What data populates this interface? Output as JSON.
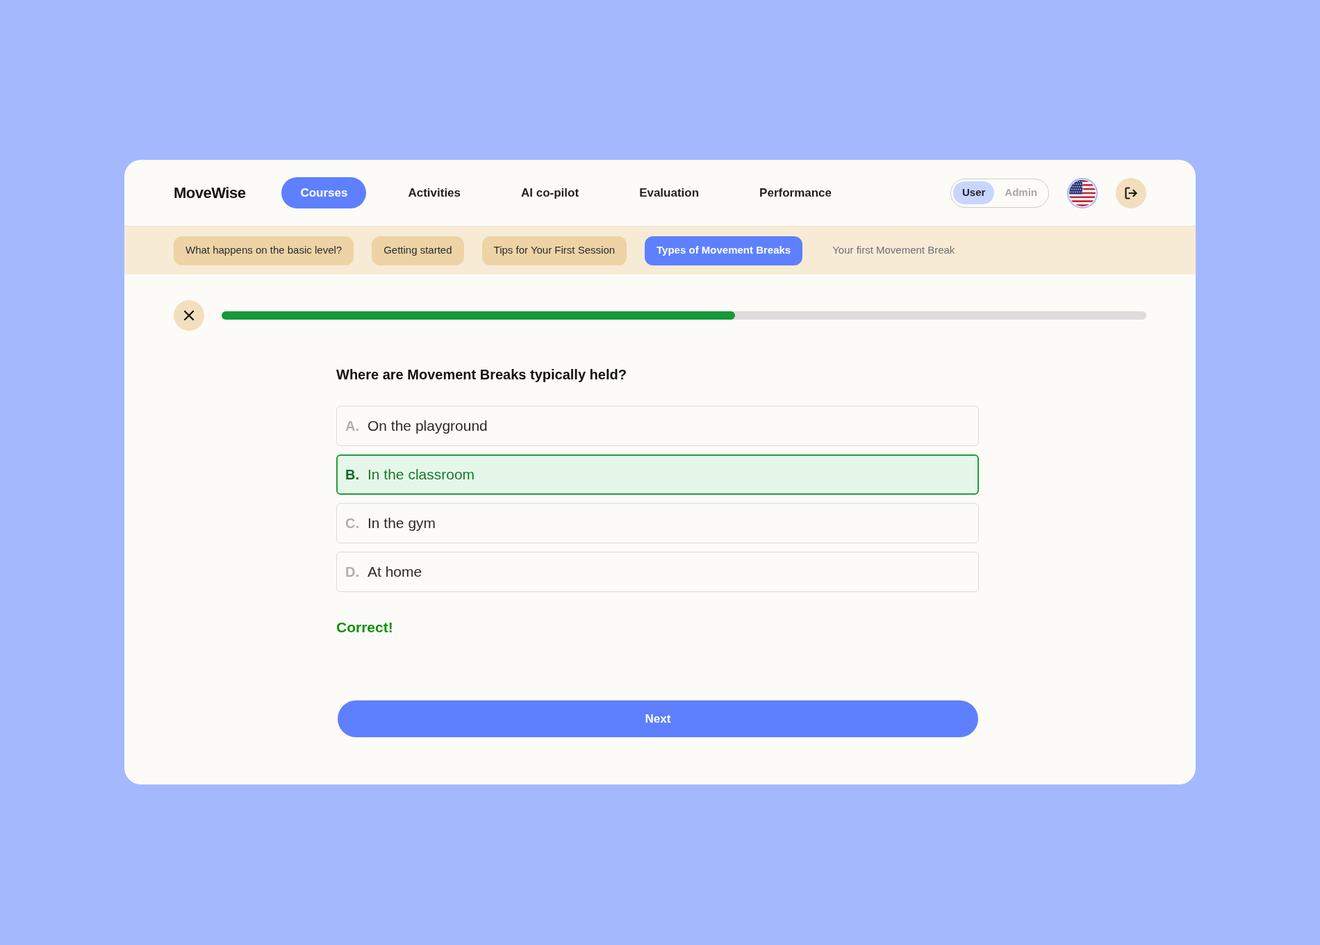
{
  "brand": "MoveWise",
  "nav": [
    {
      "label": "Courses",
      "selected": true
    },
    {
      "label": "Activities",
      "selected": false
    },
    {
      "label": "AI co-pilot",
      "selected": false
    },
    {
      "label": "Evaluation",
      "selected": false
    },
    {
      "label": "Performance",
      "selected": false
    }
  ],
  "role_toggle": [
    {
      "label": "User",
      "selected": true
    },
    {
      "label": "Admin",
      "selected": false
    }
  ],
  "lesson_tabs": [
    {
      "label": "What happens on the basic level?",
      "selected": false,
      "locked": false
    },
    {
      "label": "Getting started",
      "selected": false,
      "locked": false
    },
    {
      "label": "Tips for Your First Session",
      "selected": false,
      "locked": false
    },
    {
      "label": "Types of Movement Breaks",
      "selected": true,
      "locked": false
    },
    {
      "label": "Your first Movement Break",
      "selected": false,
      "locked": true
    }
  ],
  "progress": {
    "level": 0.555
  },
  "question": {
    "text": "Where are Movement Breaks typically held?",
    "options": [
      {
        "letter": "A.",
        "text": "On the playground",
        "selected": false
      },
      {
        "letter": "B.",
        "text": "In the classroom",
        "selected": true
      },
      {
        "letter": "C.",
        "text": "In the gym",
        "selected": false
      },
      {
        "letter": "D.",
        "text": "At home",
        "selected": false
      }
    ]
  },
  "feedback": {
    "kind": "correct",
    "text": "Correct!"
  },
  "next_button": {
    "label": "Next"
  }
}
